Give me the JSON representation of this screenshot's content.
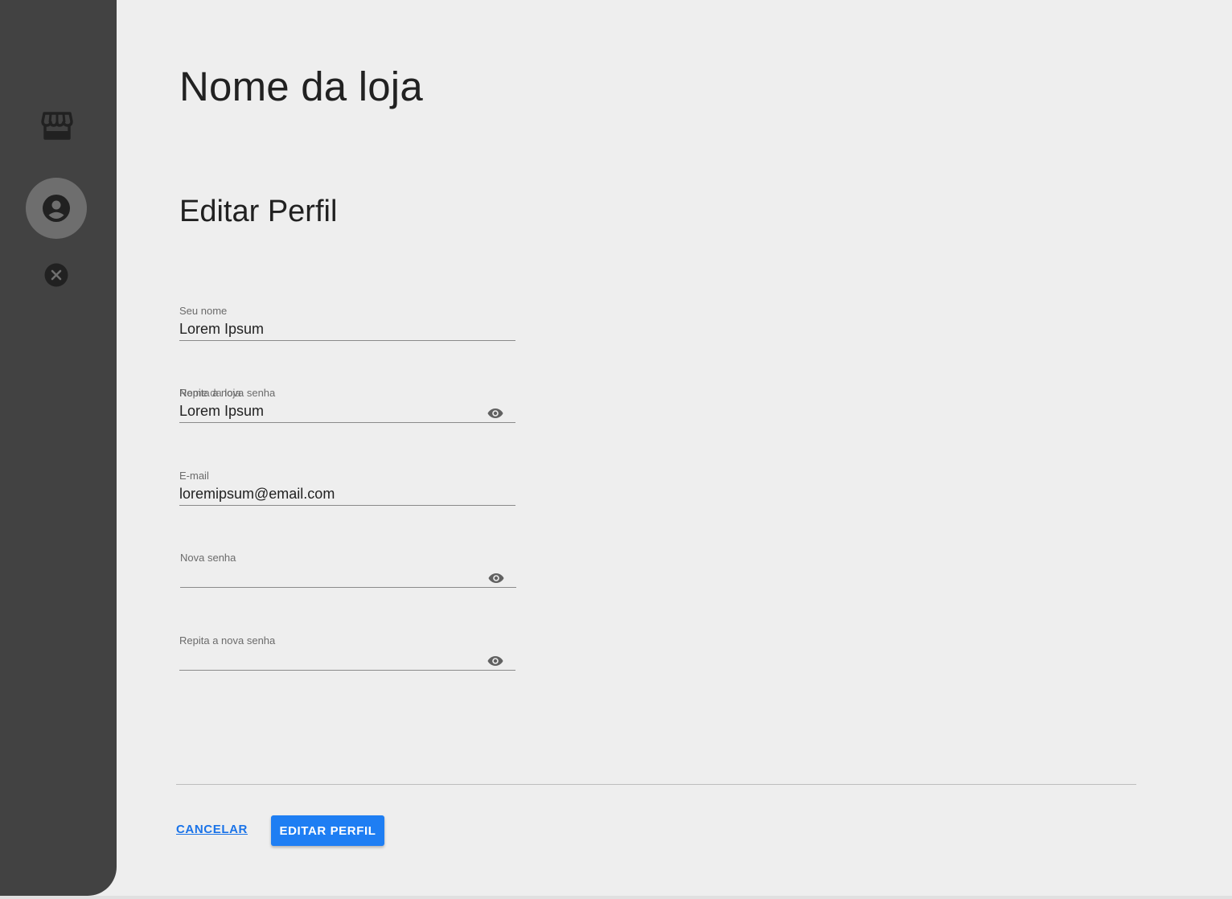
{
  "sidebar": {
    "items": [
      {
        "icon": "store-icon"
      },
      {
        "icon": "account-circle-icon",
        "active": true
      },
      {
        "icon": "close-circle-icon"
      }
    ],
    "colors": {
      "background": "#424242",
      "active_bg": "#6e6e6e",
      "icon": "#212121"
    }
  },
  "header": {
    "store_name": "Nome da loja",
    "section_title": "Editar Perfil"
  },
  "form": {
    "name": {
      "label": "Seu nome",
      "value": "Lorem Ipsum"
    },
    "store_name": {
      "label": "Nome da loja",
      "label_overlap": "Repita a nova senha",
      "value": "Lorem Ipsum"
    },
    "email": {
      "label": "E-mail",
      "value": "loremipsum@email.com"
    },
    "new_password": {
      "label": "Nova senha",
      "value": ""
    },
    "repeat_password": {
      "label": "Repita a nova senha",
      "value": ""
    }
  },
  "actions": {
    "cancel_label": "CANCELAR",
    "edit_label": "EDITAR PERFIL",
    "accent": "#1e7ef3"
  }
}
